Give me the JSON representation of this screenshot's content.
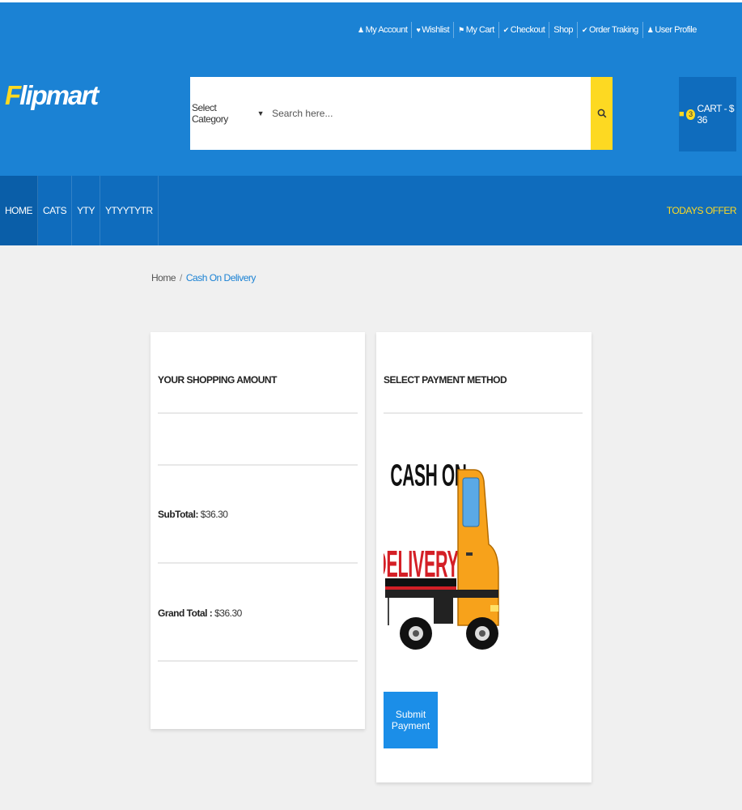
{
  "header": {
    "top_links": [
      {
        "icon": "user-icon",
        "glyph": "♟",
        "label": "My Account"
      },
      {
        "icon": "heart-icon",
        "glyph": "♥",
        "label": "Wishlist"
      },
      {
        "icon": "cart-icon",
        "glyph": "⚑",
        "label": "My Cart"
      },
      {
        "icon": "check-icon",
        "glyph": "✔",
        "label": "Checkout"
      },
      {
        "icon": "",
        "glyph": "",
        "label": "Shop"
      },
      {
        "icon": "check-icon",
        "glyph": "✔",
        "label": "Order Traking"
      },
      {
        "icon": "user-icon",
        "glyph": "♟",
        "label": "User Profile"
      }
    ],
    "logo": {
      "first": "F",
      "rest": "lipmart"
    },
    "search": {
      "category_label": "Select Category",
      "placeholder": "Search here..."
    },
    "cart": {
      "count": "3",
      "label": "CART - $ 36"
    }
  },
  "nav": {
    "items": [
      "HOME",
      "CATS",
      "YTY",
      "YTYYTYTR"
    ],
    "offer": "TODAYS OFFER"
  },
  "breadcrumb": {
    "home": "Home",
    "separator": "/",
    "current": "Cash On Delivery"
  },
  "amount_card": {
    "title": "YOUR SHOPPING AMOUNT",
    "subtotal_label": "SubTotal:",
    "subtotal_value": "$36.30",
    "grand_total_label": "Grand Total :",
    "grand_total_value": "$36.30"
  },
  "payment_card": {
    "title": "SELECT PAYMENT METHOD",
    "image_text_top": "CASH ON",
    "image_text_bottom": "DELIVERY",
    "submit_label": "Submit Payment"
  },
  "colors": {
    "header_blue": "#1b82d4",
    "nav_blue": "#0f6cbd",
    "accent_yellow": "#fdd922",
    "button_blue": "#1b8ee8",
    "delivery_red": "#d41f26"
  }
}
